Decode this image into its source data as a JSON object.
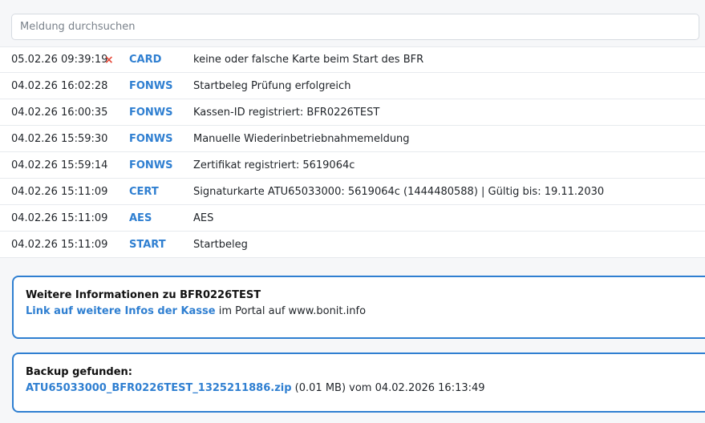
{
  "search": {
    "placeholder": "Meldung durchsuchen"
  },
  "log": [
    {
      "time": "05.02.26 09:39:19",
      "error": true,
      "error_icon": "×",
      "code": "CARD",
      "message": "keine oder falsche Karte beim Start des BFR"
    },
    {
      "time": "04.02.26 16:02:28",
      "error": false,
      "code": "FONWS",
      "message": "Startbeleg Prüfung erfolgreich"
    },
    {
      "time": "04.02.26 16:00:35",
      "error": false,
      "code": "FONWS",
      "message": "Kassen-ID registriert: BFR0226TEST"
    },
    {
      "time": "04.02.26 15:59:30",
      "error": false,
      "code": "FONWS",
      "message": "Manuelle Wiederinbetriebnahmemeldung"
    },
    {
      "time": "04.02.26 15:59:14",
      "error": false,
      "code": "FONWS",
      "message": "Zertifikat registriert: 5619064c"
    },
    {
      "time": "04.02.26 15:11:09",
      "error": false,
      "code": "CERT",
      "message": "Signaturkarte ATU65033000: 5619064c (1444480588) | Gültig bis: 19.11.2030"
    },
    {
      "time": "04.02.26 15:11:09",
      "error": false,
      "code": "AES",
      "message": "AES"
    },
    {
      "time": "04.02.26 15:11:09",
      "error": false,
      "code": "START",
      "message": "Startbeleg"
    }
  ],
  "info_box": {
    "title": "Weitere Informationen zu BFR0226TEST",
    "link_text": "Link auf weitere Infos der Kasse",
    "suffix": " im Portal auf www.bonit.info"
  },
  "backup_box": {
    "title": "Backup gefunden:",
    "file_link": "ATU65033000_BFR0226TEST_1325211886.zip",
    "details": " (0.01 MB) vom 04.02.2026 16:13:49"
  },
  "colors": {
    "accent": "#2f7fd1",
    "error": "#e74c3c"
  },
  "icons": {
    "error_marker": "close-icon"
  }
}
